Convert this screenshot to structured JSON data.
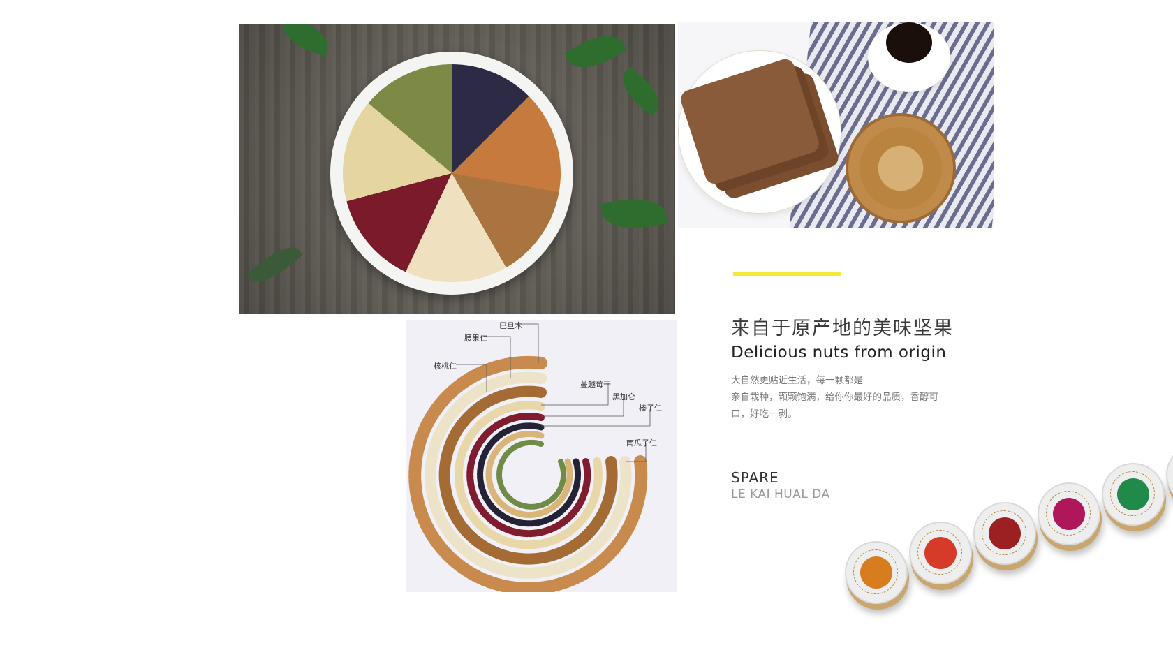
{
  "colors": {
    "accent": "#f5e837",
    "heading": "#3a3a3a",
    "body_text": "#777777",
    "muted": "#999999",
    "diagram_bg": "#f1f0f6"
  },
  "content": {
    "heading_cn": "来自于原产地的美味坚果",
    "heading_en": "Delicious nuts from origin",
    "description": [
      "大自然更贴近生活，每一颗都是",
      "亲自栽种，颗颗饱满，给你你最好的品质，香醇可",
      "口，好吃一剥。"
    ],
    "brand": "SPARE",
    "brand_sub": "LE KAI HUAL DA"
  },
  "diagram": {
    "labels": {
      "macadamia": "巴旦木",
      "cashew": "腰果仁",
      "walnut": "核桃仁",
      "cranberry": "蔓越莓干",
      "black_currant": "黑加仑",
      "hazelnut": "榛子仁",
      "pumpkin_seed": "南瓜子仁"
    }
  },
  "images": {
    "photo_plate": "nut-plate-photo",
    "photo_bread": "bread-and-nuts-photo",
    "jars": "nut-jars-photo"
  }
}
